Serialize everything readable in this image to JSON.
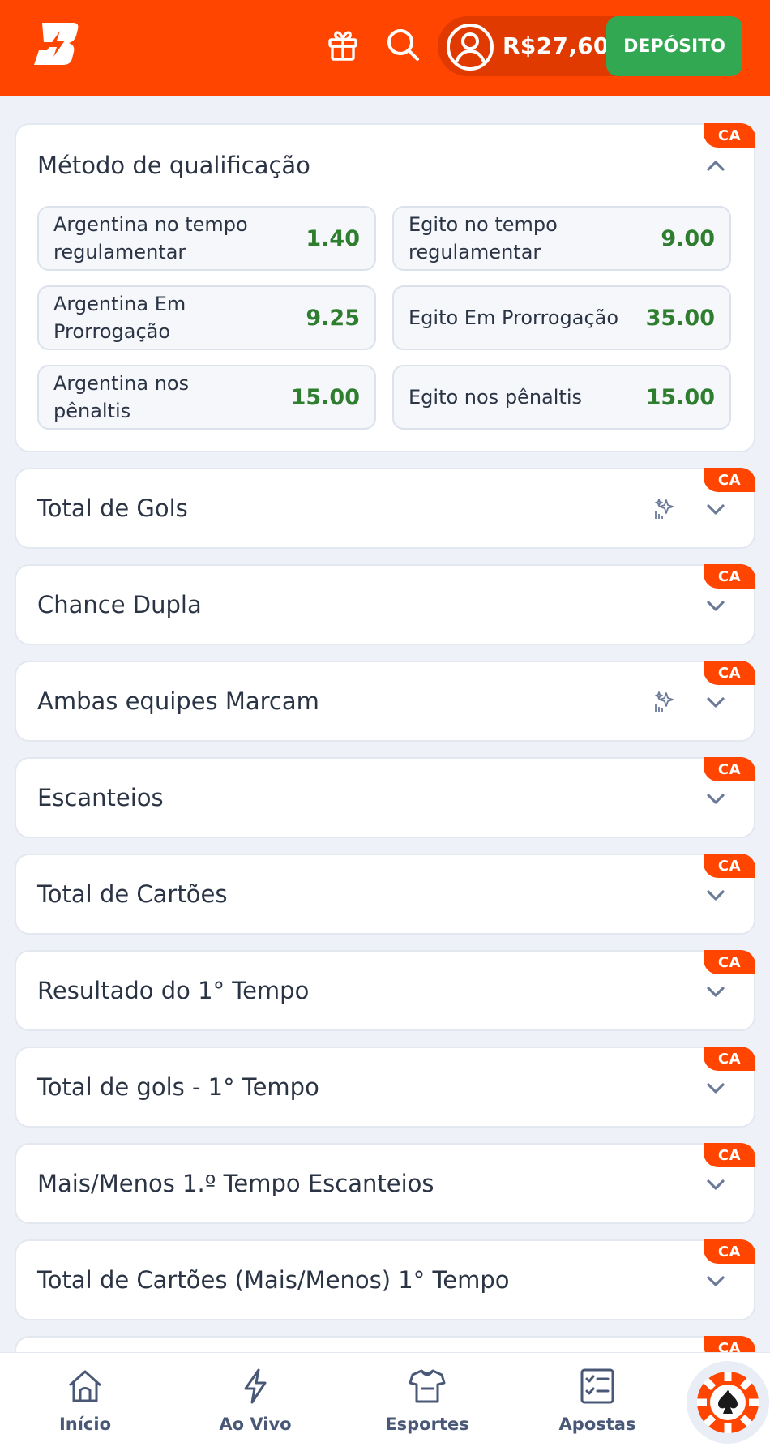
{
  "header": {
    "balance": "R$27,60",
    "deposit_label": "DEPÓSITO",
    "brand_color": "#ff4500",
    "deposit_color": "#33a853"
  },
  "badge_label": "CA",
  "expanded_market": {
    "title": "Método de qualificação",
    "outcomes": [
      {
        "label": "Argentina no tempo regulamentar",
        "odd": "1.40"
      },
      {
        "label": "Egito no tempo regulamentar",
        "odd": "9.00"
      },
      {
        "label": "Argentina Em Prorrogação",
        "odd": "9.25"
      },
      {
        "label": "Egito Em Prorrogação",
        "odd": "35.00"
      },
      {
        "label": "Argentina nos pênaltis",
        "odd": "15.00"
      },
      {
        "label": "Egito nos pênaltis",
        "odd": "15.00"
      }
    ]
  },
  "markets": [
    {
      "title": "Total de Gols",
      "sparkle": true
    },
    {
      "title": "Chance Dupla",
      "sparkle": false
    },
    {
      "title": "Ambas equipes Marcam",
      "sparkle": true
    },
    {
      "title": "Escanteios",
      "sparkle": false
    },
    {
      "title": "Total de Cartões",
      "sparkle": false
    },
    {
      "title": "Resultado do 1° Tempo",
      "sparkle": false
    },
    {
      "title": "Total de gols - 1° Tempo",
      "sparkle": false
    },
    {
      "title": "Mais/Menos 1.º Tempo Escanteios",
      "sparkle": false
    },
    {
      "title": "Total de Cartões (Mais/Menos) 1° Tempo",
      "sparkle": false
    }
  ],
  "bottom_nav": {
    "home": "Início",
    "live": "Ao Vivo",
    "sports": "Esportes",
    "bets": "Apostas"
  },
  "icons": {
    "logo": "brand-logo-icon",
    "gift": "gift-icon",
    "search": "search-icon",
    "avatar": "user-avatar-icon",
    "chevron_up": "chevron-up-icon",
    "chevron_down": "chevron-down-icon",
    "sparkle": "sparkle-icon",
    "home": "home-icon",
    "live": "lightning-icon",
    "sports": "jersey-icon",
    "bets": "checklist-icon",
    "casino": "casino-chip-icon"
  }
}
